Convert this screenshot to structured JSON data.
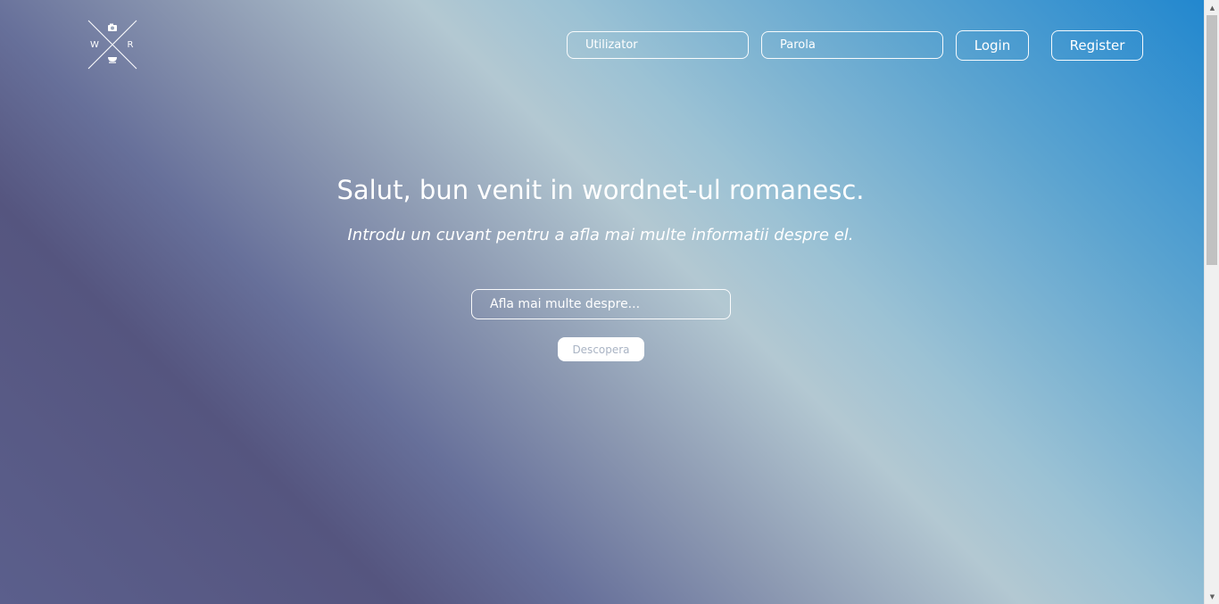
{
  "logo": {
    "letters": {
      "left": "W",
      "right": "R"
    },
    "icons": [
      "camera-icon",
      "cup-icon"
    ]
  },
  "header": {
    "username_placeholder": "Utilizator",
    "password_placeholder": "Parola",
    "login_label": "Login",
    "register_label": "Register"
  },
  "hero": {
    "title": "Salut, bun venit in wordnet-ul romanesc.",
    "subtitle": "Introdu un cuvant pentru a afla mai multe informatii despre el.",
    "search_placeholder": "Afla mai multe despre...",
    "discover_label": "Descopera"
  },
  "scrollbar": {
    "up_arrow": "▲",
    "down_arrow": "▼"
  },
  "colors": {
    "gradient_top_right": "#1f86cf",
    "gradient_middle": "#b3c8d2",
    "gradient_bottom_left": "#55557f",
    "text": "#ffffff"
  }
}
